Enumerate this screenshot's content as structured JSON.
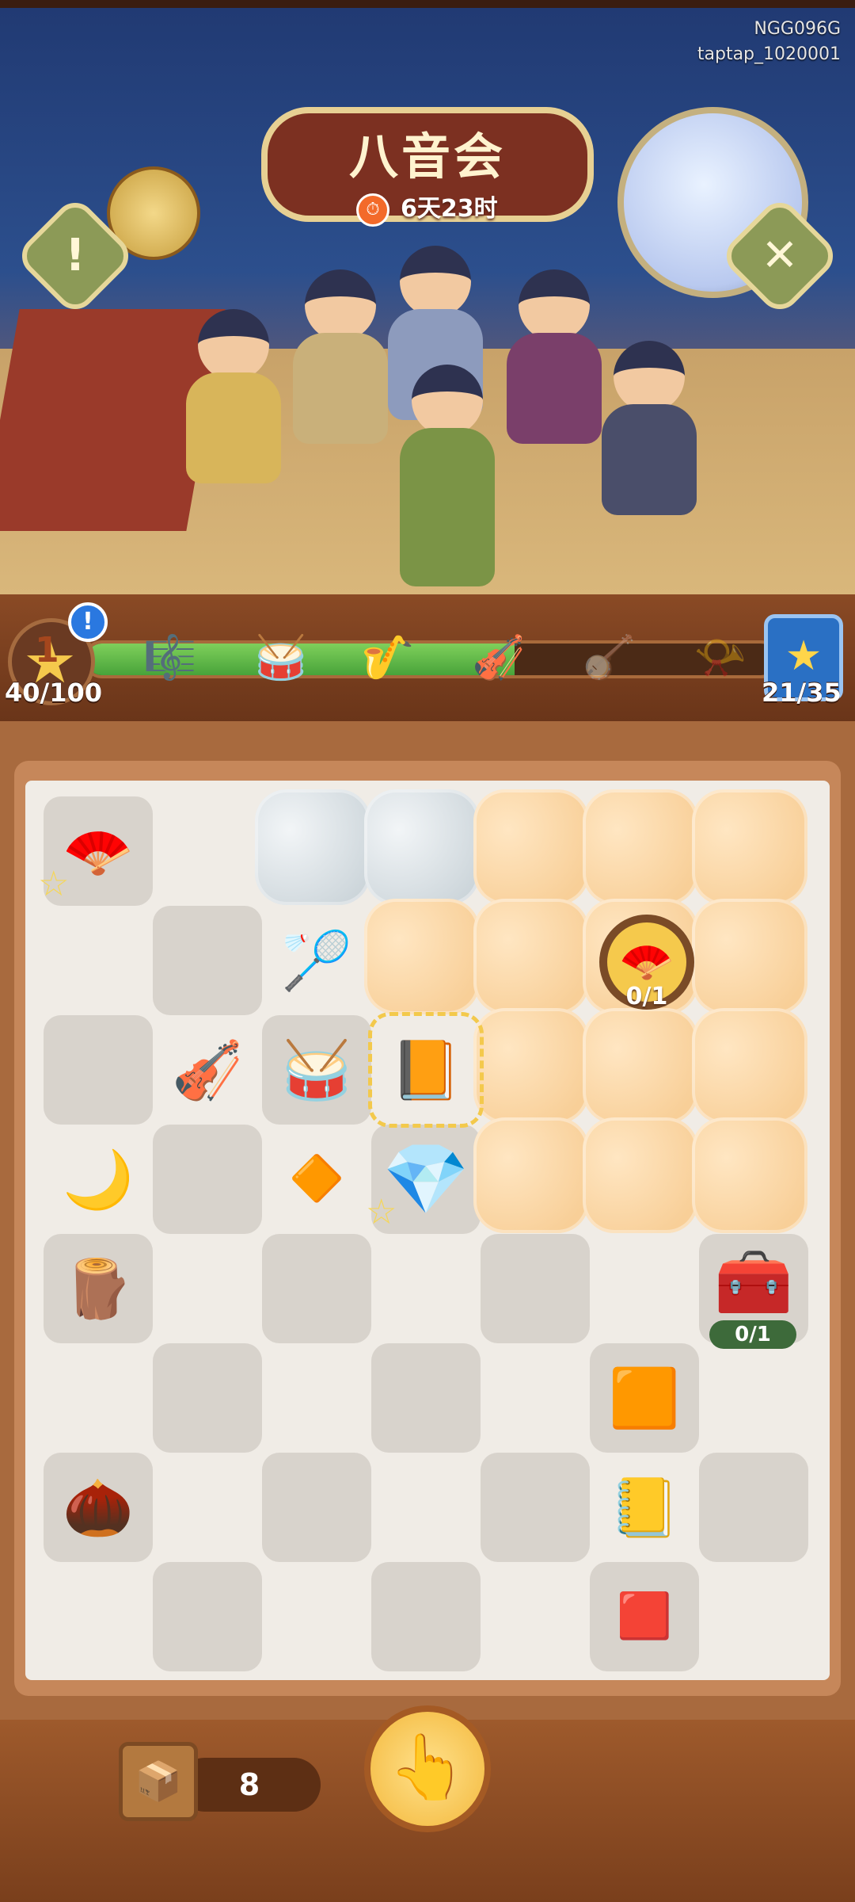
{
  "header": {
    "title": "八音会",
    "timer": "6天23时",
    "watermark_lines": [
      "NGG096G",
      "taptap_1020001"
    ],
    "info_button_label": "!",
    "close_button_label": "✕"
  },
  "progress": {
    "level": "1",
    "points_text": "40/100",
    "points_fraction": 0.4,
    "collected_text": "21/35",
    "fill_fraction": 0.62,
    "alert_label": "!",
    "instruments": [
      "panpipe",
      "drum",
      "sheng",
      "erhu",
      "pipa",
      "horn"
    ]
  },
  "board": {
    "targets": [
      {
        "id": "fan-target",
        "text": "0/1"
      },
      {
        "id": "chest-target",
        "text": "0/1"
      }
    ],
    "items": [
      {
        "name": "fan-item",
        "glyph": "🪭"
      },
      {
        "name": "round-fan-item",
        "glyph": "🏸"
      },
      {
        "name": "erhu-item",
        "glyph": "🎻"
      },
      {
        "name": "drum-item",
        "glyph": "🥁"
      },
      {
        "name": "book-item",
        "glyph": "📙"
      },
      {
        "name": "green-moon-item",
        "glyph": "🌙"
      },
      {
        "name": "amber-shard-item",
        "glyph": "🔶"
      },
      {
        "name": "emerald-item",
        "glyph": "💎"
      },
      {
        "name": "wood-plank-item",
        "glyph": "🪵"
      },
      {
        "name": "treasure-chest-item",
        "glyph": "🧰"
      },
      {
        "name": "amber-gem-item",
        "glyph": "🟧"
      },
      {
        "name": "ocarina-item",
        "glyph": "🌰"
      },
      {
        "name": "book-item-2",
        "glyph": "📒"
      },
      {
        "name": "ruby-item",
        "glyph": "🟥"
      }
    ]
  },
  "bottom": {
    "count": "8",
    "crate_glyph": "📦",
    "tap_glyph": "👆"
  },
  "colors": {
    "accent": "#f5c94c",
    "progress_green": "#48a33a",
    "frame_brown": "#a86a3e"
  }
}
